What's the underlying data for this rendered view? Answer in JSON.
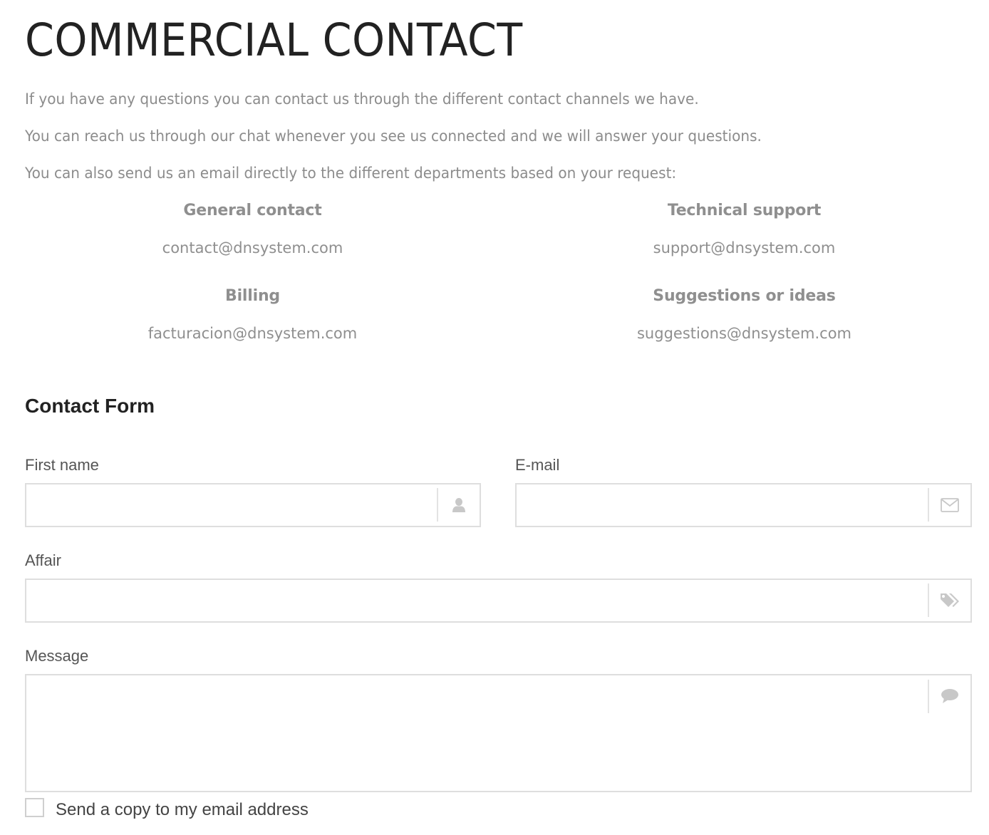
{
  "header": {
    "title": "COMMERCIAL CONTACT"
  },
  "intro": {
    "line1": "If you have any questions you can contact us through the different contact channels we have.",
    "line2": "You can reach us through our chat whenever you see us connected and we will answer your questions.",
    "line3": "You can also send us an email directly to the different departments based on your request:"
  },
  "departments": [
    {
      "name": "General contact",
      "email": "contact@dnsystem.com"
    },
    {
      "name": "Technical support",
      "email": "support@dnsystem.com"
    },
    {
      "name": "Billing",
      "email": "facturacion@dnsystem.com"
    },
    {
      "name": "Suggestions or ideas",
      "email": "suggestions@dnsystem.com"
    }
  ],
  "form": {
    "title": "Contact Form",
    "first_name": {
      "label": "First name",
      "value": "",
      "icon": "user-icon"
    },
    "email": {
      "label": "E-mail",
      "value": "",
      "icon": "envelope-icon"
    },
    "affair": {
      "label": "Affair",
      "value": "",
      "icon": "tags-icon"
    },
    "message": {
      "label": "Message",
      "value": "",
      "icon": "comment-icon"
    },
    "copy_checkbox": {
      "label": "Send a copy to my email address",
      "checked": false
    }
  },
  "colors": {
    "title_text": "#222222",
    "muted_text": "#8c8c8c",
    "label_text": "#555555",
    "input_border": "#dedede",
    "icon_color": "#c8c8c8"
  }
}
